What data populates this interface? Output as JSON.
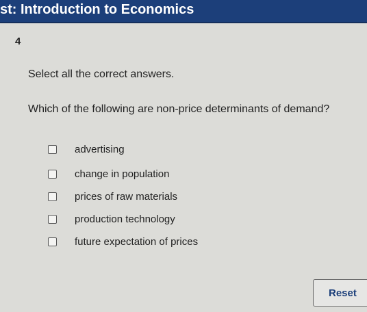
{
  "header": {
    "title": "st: Introduction to Economics"
  },
  "question": {
    "number": "4",
    "instruction": "Select all the correct answers.",
    "prompt": "Which of the following are non-price determinants of demand?",
    "choices": [
      {
        "label": "advertising",
        "checked": false
      },
      {
        "label": "change in population",
        "checked": false
      },
      {
        "label": "prices of raw materials",
        "checked": false
      },
      {
        "label": "production technology",
        "checked": false
      },
      {
        "label": "future expectation of prices",
        "checked": false
      }
    ]
  },
  "actions": {
    "reset_label": "Reset"
  },
  "colors": {
    "header_bg": "#1c3f7a",
    "page_bg": "#dcdcd8",
    "accent_text": "#1c3f7a"
  }
}
